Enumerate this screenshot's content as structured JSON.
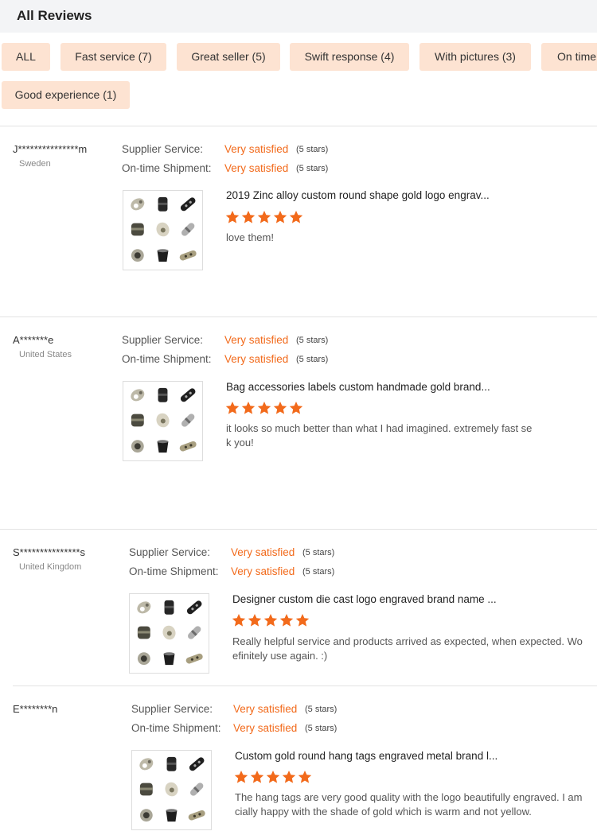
{
  "header": {
    "title": "All Reviews"
  },
  "filters": [
    {
      "label": "ALL"
    },
    {
      "label": "Fast service (7)"
    },
    {
      "label": "Great seller (5)"
    },
    {
      "label": "Swift response (4)"
    },
    {
      "label": "With pictures (3)"
    },
    {
      "label": "On time"
    },
    {
      "label": "Good experience (1)"
    }
  ],
  "rating_labels": {
    "supplier": "Supplier Service:",
    "shipment": "On-time Shipment:"
  },
  "colors": {
    "accent": "#f26a1b",
    "tag_bg": "#fde3d2",
    "header_bg": "#f3f4f6"
  },
  "reviews": [
    {
      "user": "J***************m",
      "country": "Sweden",
      "supplier_rating": "Very satisfied",
      "supplier_stars": "(5 stars)",
      "shipment_rating": "Very satisfied",
      "shipment_stars": "(5 stars)",
      "product_title": "2019 Zinc alloy custom round shape gold logo engrav...",
      "product_rating": 5,
      "comment": "love them!"
    },
    {
      "user": "A*******e",
      "country": "United States",
      "supplier_rating": "Very satisfied",
      "supplier_stars": "(5 stars)",
      "shipment_rating": "Very satisfied",
      "shipment_stars": "(5 stars)",
      "product_title": "Bag accessories labels custom handmade gold brand...",
      "product_rating": 5,
      "comment": "it looks so much better than what I had imagined. extremely fast se\nk you!"
    },
    {
      "user": "S***************s",
      "country": "United Kingdom",
      "supplier_rating": "Very satisfied",
      "supplier_stars": "(5 stars)",
      "shipment_rating": "Very satisfied",
      "shipment_stars": "(5 stars)",
      "product_title": "Designer custom die cast logo engraved brand name ...",
      "product_rating": 5,
      "comment": "Really helpful service and products arrived as expected, when expected.  Wo\nefinitely use again.  :)"
    },
    {
      "user": "E********n",
      "country": "",
      "supplier_rating": "Very satisfied",
      "supplier_stars": "(5 stars)",
      "shipment_rating": "Very satisfied",
      "shipment_stars": "(5 stars)",
      "product_title": "Custom gold round hang tags engraved metal brand l...",
      "product_rating": 5,
      "comment": "The hang tags are very good quality with the logo beautifully engraved. I am\ncially happy with the shade of gold which is warm and not yellow."
    }
  ]
}
